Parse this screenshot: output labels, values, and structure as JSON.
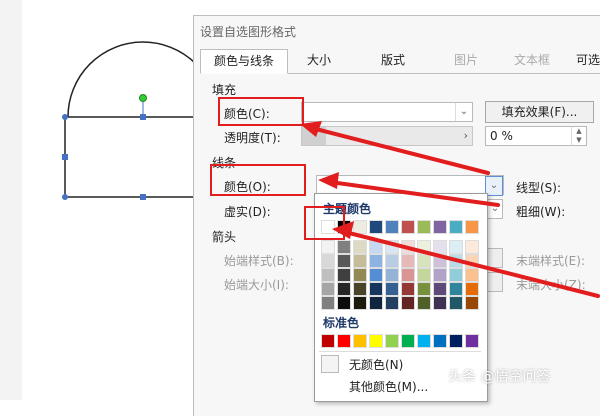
{
  "dialog": {
    "title": "设置自选图形格式",
    "tabs": [
      {
        "label": "颜色与线条",
        "active": true
      },
      {
        "label": "大小"
      },
      {
        "label": "版式"
      },
      {
        "label": "图片",
        "disabled": true
      },
      {
        "label": "文本框",
        "disabled": true
      },
      {
        "label": "可选"
      }
    ]
  },
  "fill": {
    "section": "填充",
    "color_label": "颜色(C):",
    "color_value": "",
    "effects_button": "填充效果(F)...",
    "transparency_label": "透明度(T):",
    "transparency_value": "0 %"
  },
  "line": {
    "section": "线条",
    "color_label": "颜色(O):",
    "color_value": "",
    "dash_label": "虚实(D):",
    "style_label": "线型(S):",
    "weight_label": "粗细(W):"
  },
  "arrows": {
    "section": "箭头",
    "begin_style_label": "始端样式(B):",
    "begin_size_label": "始端大小(I):",
    "end_style_label": "末端样式(E):",
    "end_size_label": "末端大小(Z):"
  },
  "color_picker": {
    "theme_header": "主题颜色",
    "standard_header": "标准色",
    "theme_top": [
      "#ffffff",
      "#000000",
      "#eeece1",
      "#1f497d",
      "#4f81bd",
      "#c0504d",
      "#9bbb59",
      "#8064a2",
      "#4bacc6",
      "#f79646"
    ],
    "theme_shades": [
      [
        "#f2f2f2",
        "#7f7f7f",
        "#ddd9c3",
        "#c6d9f0",
        "#dbe5f1",
        "#f2dcdb",
        "#ebf1dd",
        "#e5e0ec",
        "#dbeef3",
        "#fdeada"
      ],
      [
        "#d8d8d8",
        "#595959",
        "#c4bd97",
        "#8db3e2",
        "#b8cce4",
        "#e5b9b7",
        "#d7e3bc",
        "#ccc1d9",
        "#b7dde8",
        "#fbd5b5"
      ],
      [
        "#bfbfbf",
        "#3f3f3f",
        "#938953",
        "#548dd4",
        "#95b3d7",
        "#d99694",
        "#c3d69b",
        "#b2a2c7",
        "#92cddc",
        "#fac08f"
      ],
      [
        "#a5a5a5",
        "#262626",
        "#494429",
        "#17365d",
        "#366092",
        "#953734",
        "#76923c",
        "#5f497a",
        "#31859b",
        "#e36c09"
      ],
      [
        "#7f7f7f",
        "#0c0c0c",
        "#1d1b10",
        "#0f243e",
        "#244061",
        "#632423",
        "#4f6128",
        "#3f3151",
        "#205867",
        "#974806"
      ]
    ],
    "standard": [
      "#c00000",
      "#ff0000",
      "#ffc000",
      "#ffff00",
      "#92d050",
      "#00b050",
      "#00b0f0",
      "#0070c0",
      "#002060",
      "#7030a0"
    ],
    "no_color": "无颜色(N)",
    "more_colors": "其他颜色(M)..."
  },
  "watermark": "头条 @悟空问答",
  "colors": {
    "annotation_red": "#e21d1d",
    "selection_handle": "#4472c4",
    "rotate_handle": "#22bb22"
  }
}
